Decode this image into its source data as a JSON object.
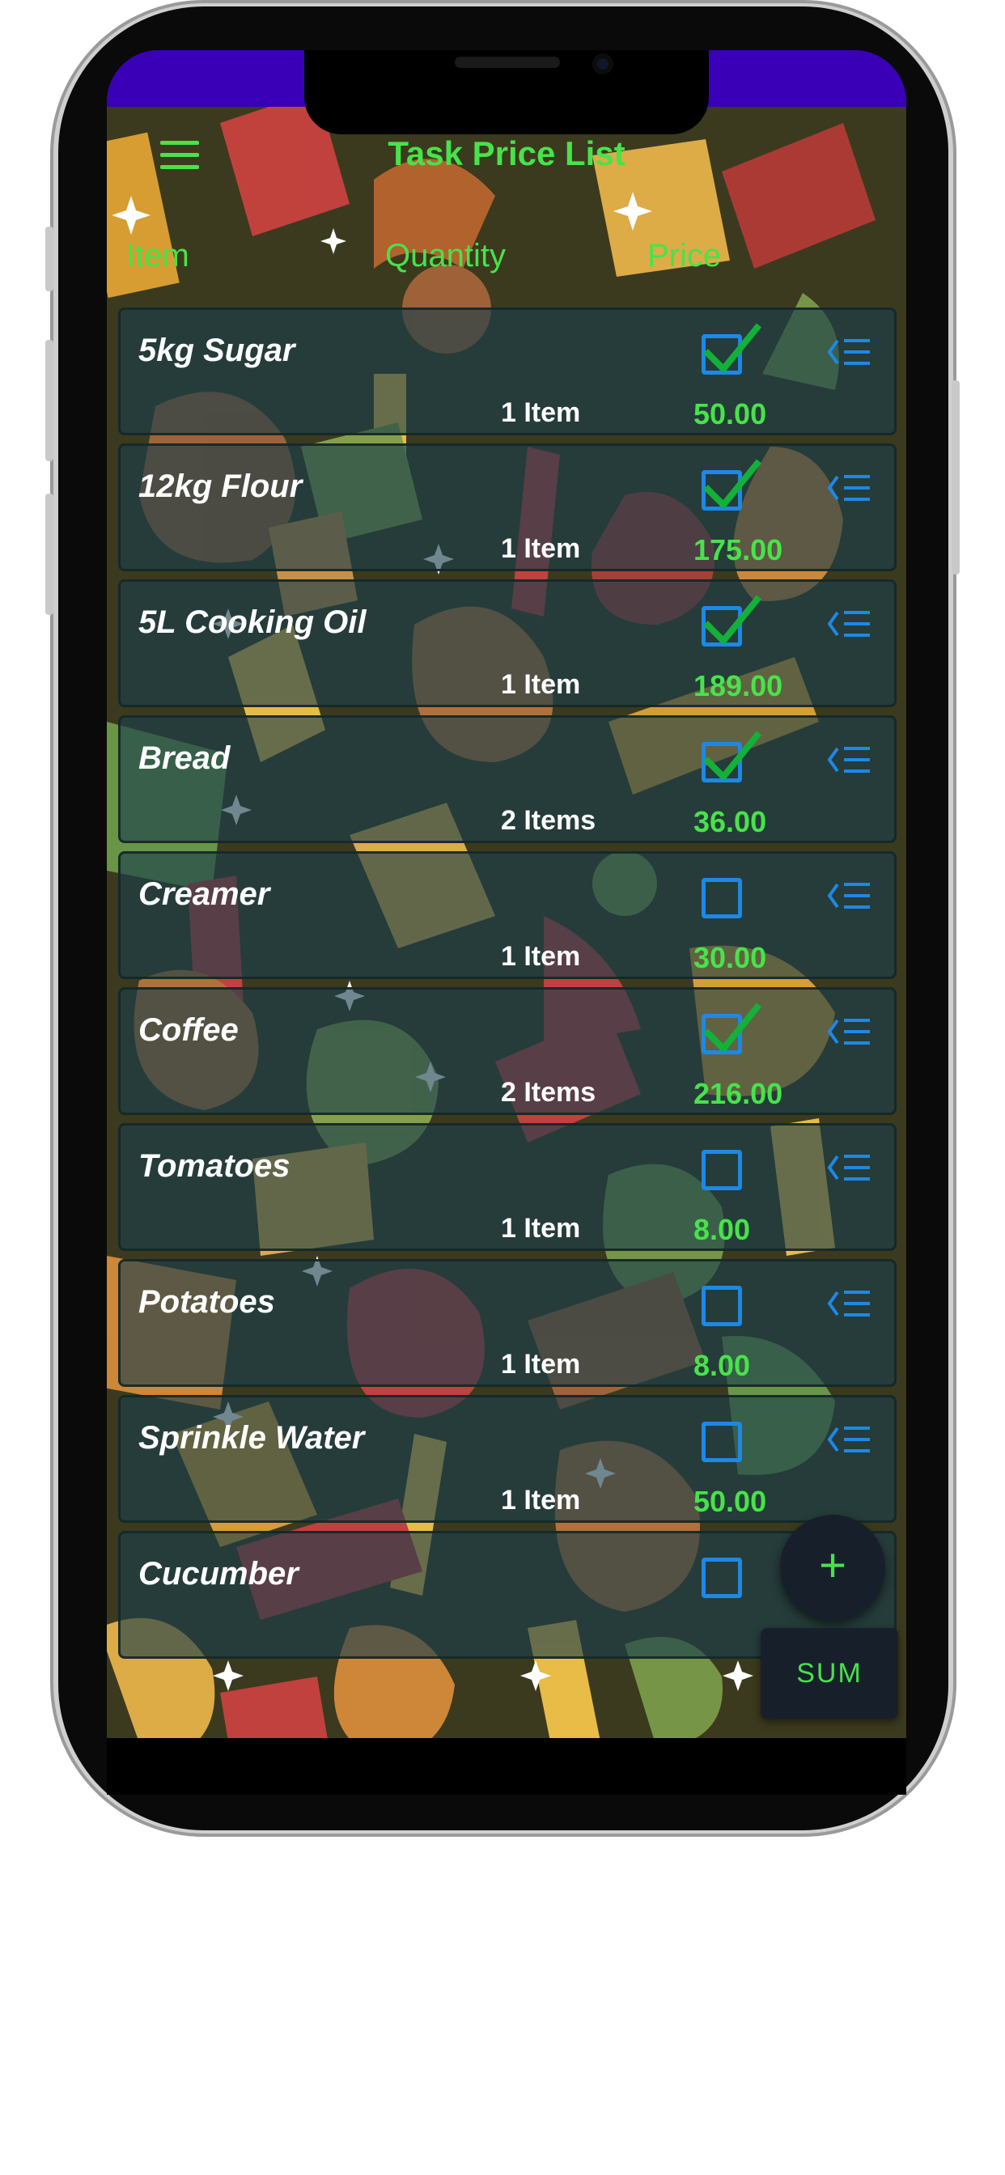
{
  "app": {
    "title": "Task Price List",
    "accent_color": "#47e34a",
    "status_bar_color": "#3a00b8"
  },
  "header": {
    "menu_icon": "hamburger-menu-icon",
    "columns": [
      "Item",
      "Quantity",
      "Price"
    ]
  },
  "items": [
    {
      "name": "5kg Sugar",
      "quantity": "1 Item",
      "price": "50.00",
      "checked": true
    },
    {
      "name": "12kg Flour",
      "quantity": "1 Item",
      "price": "175.00",
      "checked": true
    },
    {
      "name": "5L Cooking Oil",
      "quantity": "1 Item",
      "price": "189.00",
      "checked": true
    },
    {
      "name": "Bread",
      "quantity": "2  Items",
      "price": "36.00",
      "checked": true
    },
    {
      "name": "Creamer",
      "quantity": "1 Item",
      "price": "30.00",
      "checked": false
    },
    {
      "name": "Coffee",
      "quantity": "2  Items",
      "price": "216.00",
      "checked": true
    },
    {
      "name": "Tomatoes",
      "quantity": "1 Item",
      "price": "8.00",
      "checked": false
    },
    {
      "name": "Potatoes",
      "quantity": "1 Item",
      "price": "8.00",
      "checked": false
    },
    {
      "name": "Sprinkle Water",
      "quantity": "1 Item",
      "price": "50.00",
      "checked": false
    },
    {
      "name": "Cucumber",
      "quantity": "",
      "price": "",
      "checked": false
    }
  ],
  "actions": {
    "add_label": "+",
    "sum_label": "SUM"
  }
}
